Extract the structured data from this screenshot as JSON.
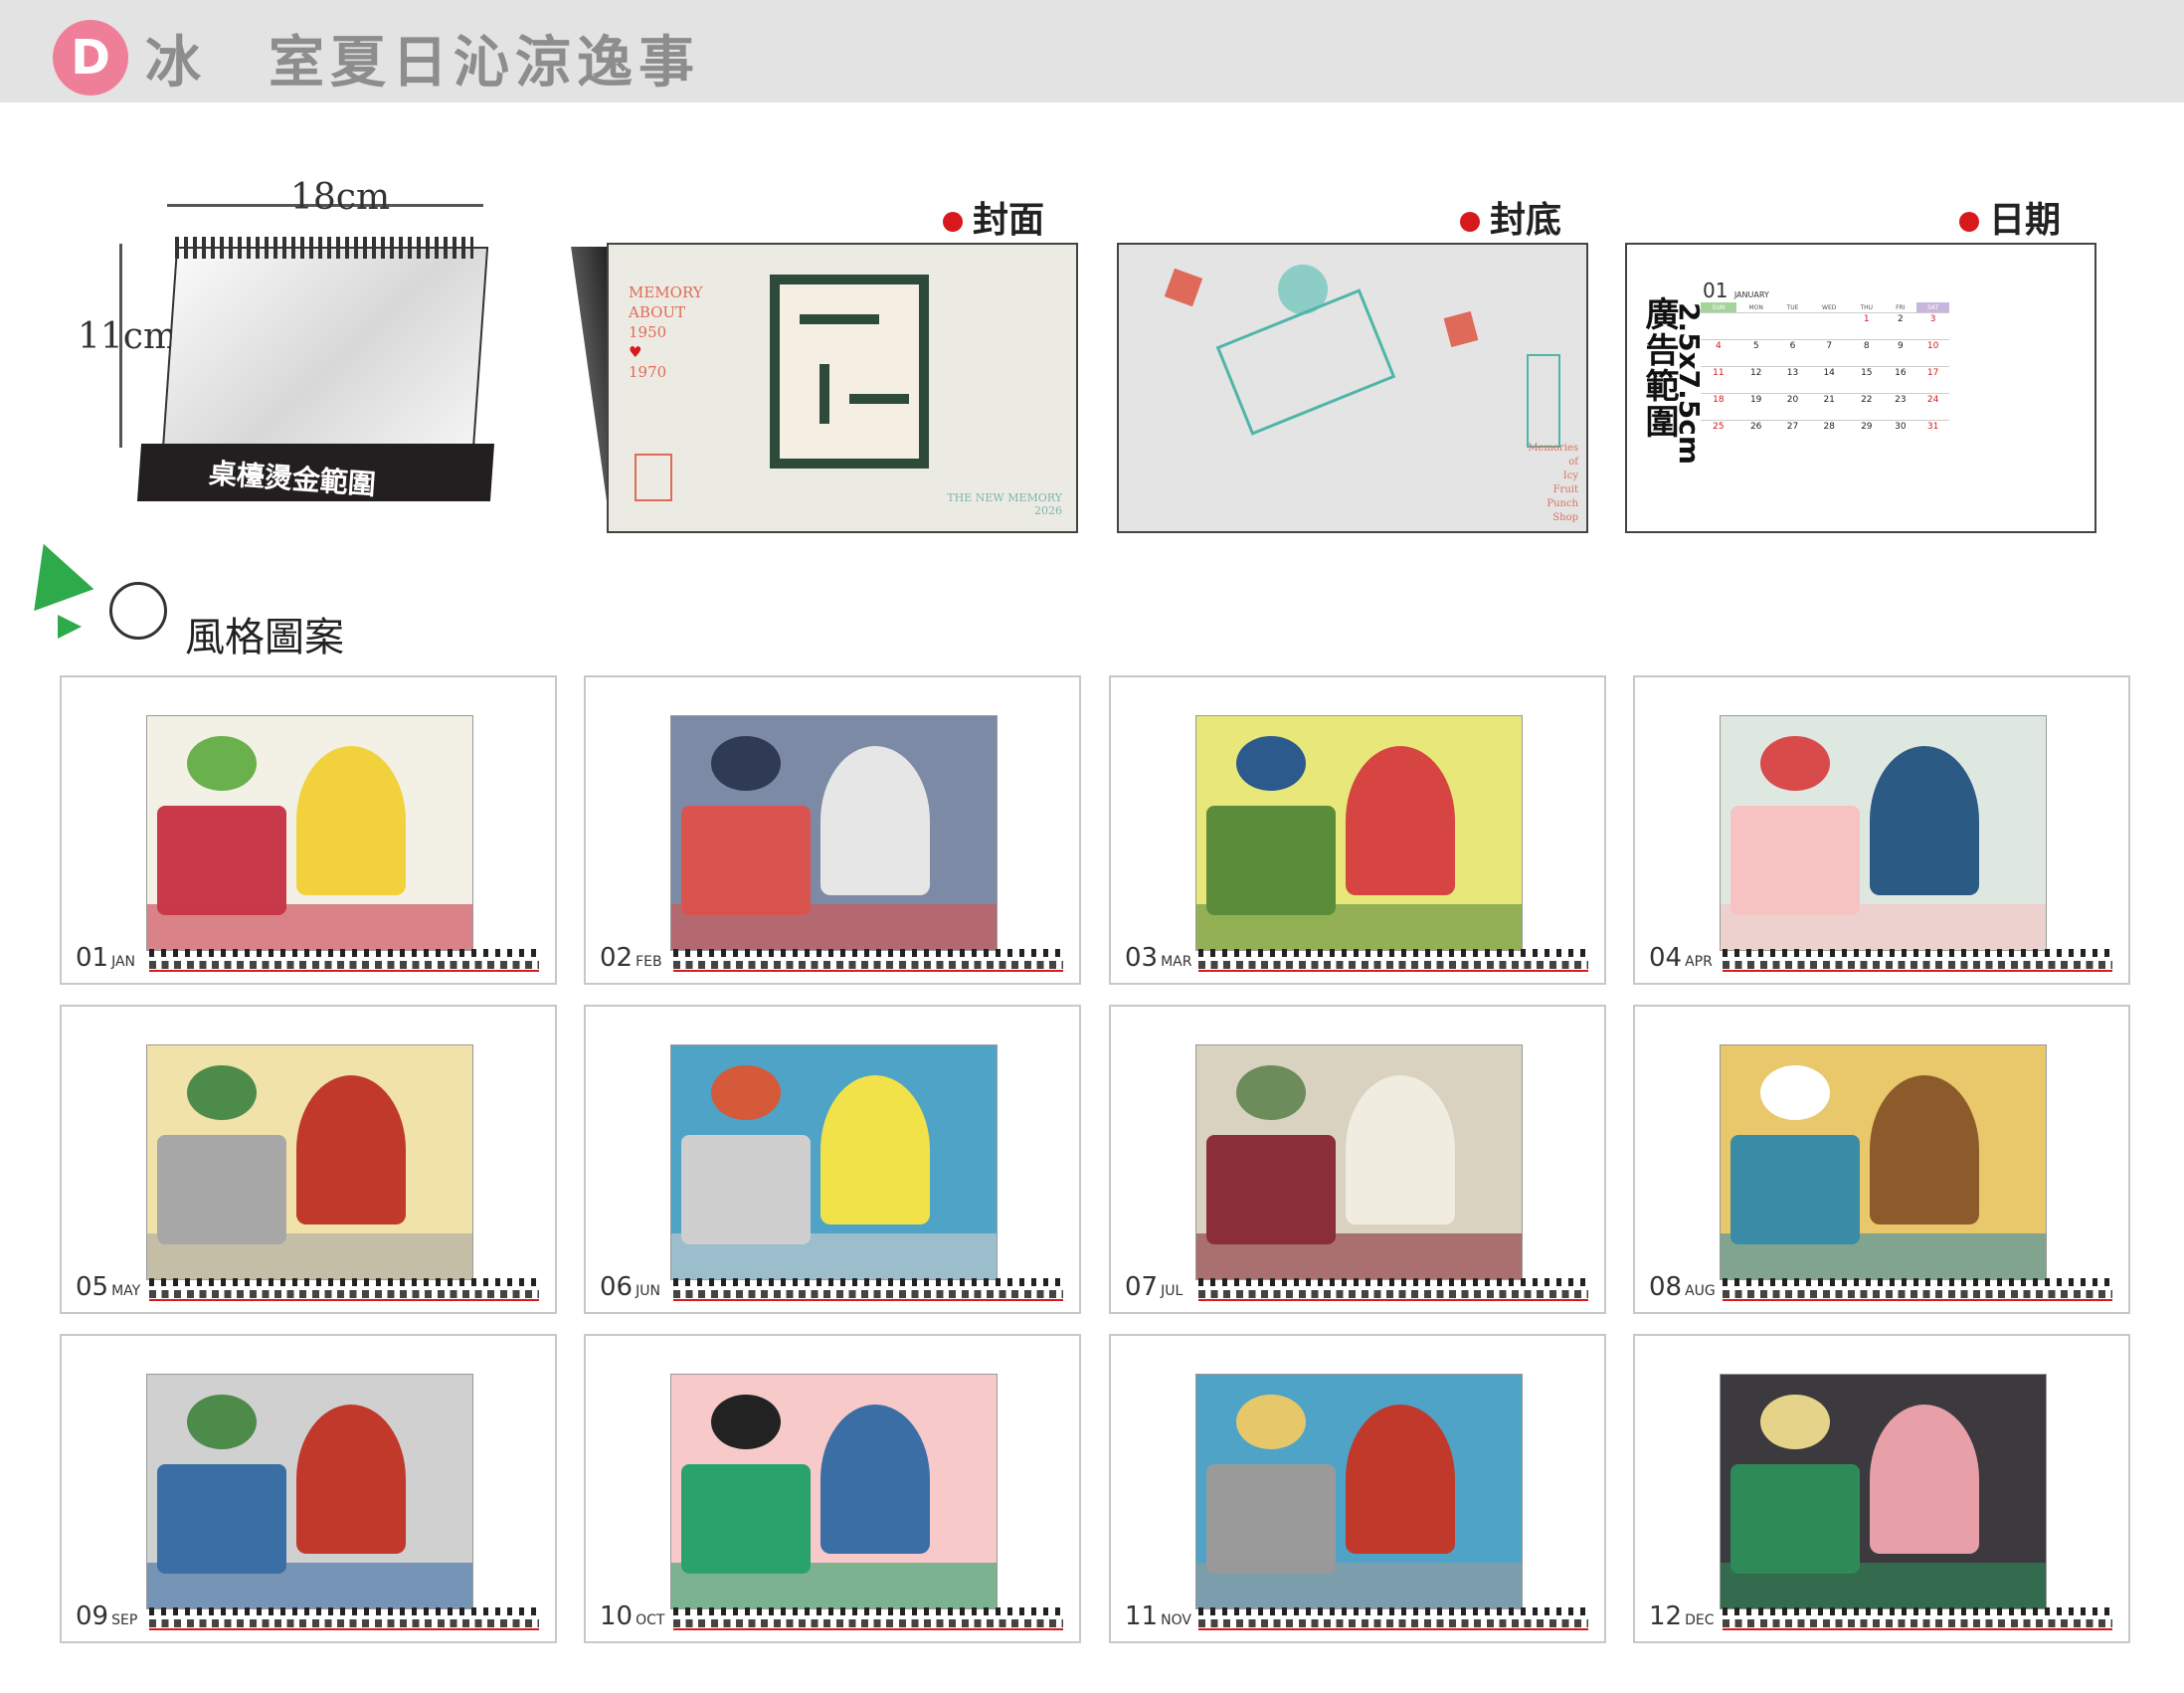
{
  "header": {
    "badge": "D",
    "word1": "冰",
    "word2": "室夏日沁涼逸事"
  },
  "mockup": {
    "width_label": "18cm",
    "height_label": "11cm",
    "base_label": "桌檯燙金範圍"
  },
  "sections": {
    "cover": "封面",
    "back": "封底",
    "date": "日期"
  },
  "cover": {
    "lines": [
      "MEMORY",
      "ABOUT",
      "1950",
      "1970"
    ],
    "footer": [
      "THE NEW MEMORY",
      "2026"
    ]
  },
  "back": {
    "lines": [
      "Memories",
      "of",
      "Icy",
      "Fruit",
      "Punch",
      "Shop"
    ]
  },
  "datepanel": {
    "vertical_label": "廣告範圍",
    "size_label": "2.5x7.5cm",
    "month_num": "01",
    "month_name": "JANUARY",
    "weekdays": [
      "SUN",
      "MON",
      "TUE",
      "WED",
      "THU",
      "FRI",
      "SAT"
    ],
    "weeks": [
      [
        "",
        "",
        "",
        "",
        "1",
        "2",
        "3"
      ],
      [
        "4",
        "5",
        "6",
        "7",
        "8",
        "9",
        "10"
      ],
      [
        "11",
        "12",
        "13",
        "14",
        "15",
        "16",
        "17"
      ],
      [
        "18",
        "19",
        "20",
        "21",
        "22",
        "23",
        "24"
      ],
      [
        "25",
        "26",
        "27",
        "28",
        "29",
        "30",
        "31"
      ]
    ]
  },
  "style_label": "風格圖案",
  "months": [
    {
      "num": "01",
      "name": "JAN",
      "bg": "#f3f0e6",
      "c1": "#c8394a",
      "c2": "#f2d23c",
      "c3": "#6ab04c"
    },
    {
      "num": "02",
      "name": "FEB",
      "bg": "#7d8aa6",
      "c1": "#d9534f",
      "c2": "#e6e6e6",
      "c3": "#2f3b55"
    },
    {
      "num": "03",
      "name": "MAR",
      "bg": "#e8e77a",
      "c1": "#5b8c3a",
      "c2": "#d64541",
      "c3": "#2d5a8c"
    },
    {
      "num": "04",
      "name": "APR",
      "bg": "#dfe8e0",
      "c1": "#f7c2c2",
      "c2": "#2b5b85",
      "c3": "#d94b4b"
    },
    {
      "num": "05",
      "name": "MAY",
      "bg": "#f0e2a8",
      "c1": "#a7a7a7",
      "c2": "#c0392b",
      "c3": "#4d8b4b"
    },
    {
      "num": "06",
      "name": "JUN",
      "bg": "#4fa3c7",
      "c1": "#cfcfcf",
      "c2": "#f2e24a",
      "c3": "#d45a3a"
    },
    {
      "num": "07",
      "name": "JUL",
      "bg": "#d9d2c0",
      "c1": "#8b2f3a",
      "c2": "#f0ece0",
      "c3": "#6c8c5c"
    },
    {
      "num": "08",
      "name": "AUG",
      "bg": "#e8c86a",
      "c1": "#3a8ca6",
      "c2": "#8c5a2b",
      "c3": "#ffffff"
    },
    {
      "num": "09",
      "name": "SEP",
      "bg": "#d0d0d0",
      "c1": "#3a6ea5",
      "c2": "#c0392b",
      "c3": "#4d8b4b"
    },
    {
      "num": "10",
      "name": "OCT",
      "bg": "#f7c9c9",
      "c1": "#2aa36b",
      "c2": "#3a6ea5",
      "c3": "#222222"
    },
    {
      "num": "11",
      "name": "NOV",
      "bg": "#4fa3c7",
      "c1": "#9a9a9a",
      "c2": "#c0392b",
      "c3": "#e6c86a"
    },
    {
      "num": "12",
      "name": "DEC",
      "bg": "#3c3a3f",
      "c1": "#2e8b57",
      "c2": "#e8a0a8",
      "c3": "#e6d38a"
    }
  ]
}
